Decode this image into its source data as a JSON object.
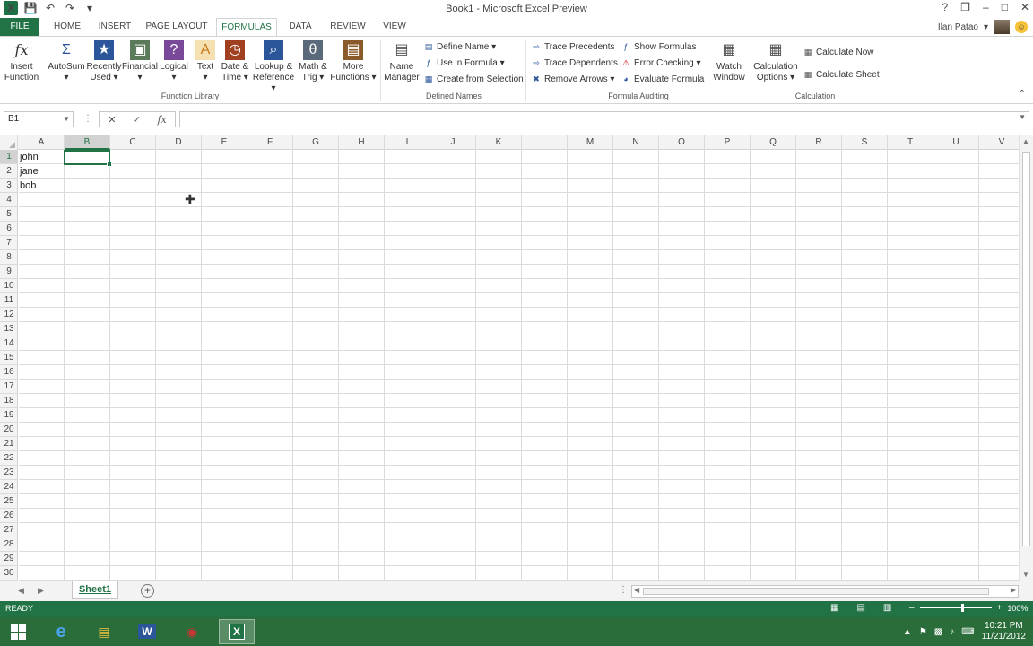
{
  "window": {
    "title": "Book1 - Microsoft Excel Preview",
    "app_icon_label": "X",
    "controls": [
      "?",
      "❒",
      "–",
      "□",
      "✕"
    ]
  },
  "user": {
    "name": "Ilan Patao"
  },
  "tabs": [
    {
      "label": "FILE"
    },
    {
      "label": "HOME"
    },
    {
      "label": "INSERT"
    },
    {
      "label": "PAGE LAYOUT"
    },
    {
      "label": "FORMULAS"
    },
    {
      "label": "DATA"
    },
    {
      "label": "REVIEW"
    },
    {
      "label": "VIEW"
    }
  ],
  "ribbon": {
    "function_library": {
      "label": "Function Library",
      "buttons": [
        {
          "line1": "Insert",
          "line2": "Function",
          "icon": "fx"
        },
        {
          "line1": "AutoSum",
          "line2": "▾",
          "icon": "Σ"
        },
        {
          "line1": "Recently",
          "line2": "Used ▾",
          "icon": "★"
        },
        {
          "line1": "Financial",
          "line2": "▾",
          "icon": "▣"
        },
        {
          "line1": "Logical",
          "line2": "▾",
          "icon": "?"
        },
        {
          "line1": "Text",
          "line2": "▾",
          "icon": "A"
        },
        {
          "line1": "Date &",
          "line2": "Time ▾",
          "icon": "◷"
        },
        {
          "line1": "Lookup &",
          "line2": "Reference ▾",
          "icon": "⌕"
        },
        {
          "line1": "Math &",
          "line2": "Trig ▾",
          "icon": "θ"
        },
        {
          "line1": "More",
          "line2": "Functions ▾",
          "icon": "▤"
        }
      ]
    },
    "defined_names": {
      "label": "Defined Names",
      "name_manager": {
        "line1": "Name",
        "line2": "Manager"
      },
      "items": [
        "Define Name ▾",
        "Use in Formula ▾",
        "Create from Selection"
      ]
    },
    "formula_auditing": {
      "label": "Formula Auditing",
      "items_left": [
        "Trace Precedents",
        "Trace Dependents",
        "Remove Arrows ▾"
      ],
      "items_right": [
        "Show Formulas",
        "Error Checking ▾",
        "Evaluate Formula"
      ],
      "watch_window": {
        "line1": "Watch",
        "line2": "Window"
      }
    },
    "calculation": {
      "label": "Calculation",
      "options": {
        "line1": "Calculation",
        "line2": "Options ▾"
      },
      "items": [
        "Calculate Now",
        "Calculate Sheet"
      ]
    }
  },
  "formula_bar": {
    "name_box": "B1",
    "formula": "",
    "buttons": [
      "✕",
      "✓",
      "fx"
    ]
  },
  "grid": {
    "columns": [
      "A",
      "B",
      "C",
      "D",
      "E",
      "F",
      "G",
      "H",
      "I",
      "J",
      "K",
      "L",
      "M",
      "N",
      "O",
      "P",
      "Q",
      "R",
      "S",
      "T",
      "U",
      "V"
    ],
    "rows": [
      "1",
      "2",
      "3",
      "4",
      "5",
      "6",
      "7",
      "8",
      "9",
      "10",
      "11",
      "12",
      "13",
      "14",
      "15",
      "16",
      "17",
      "18",
      "19",
      "20",
      "21",
      "22",
      "23",
      "24",
      "25",
      "26",
      "27",
      "28",
      "29",
      "30"
    ],
    "selected_column": "B",
    "selected_row": "1",
    "cells": [
      {
        "ref": "A1",
        "value": "john"
      },
      {
        "ref": "A2",
        "value": "jane"
      },
      {
        "ref": "A3",
        "value": "bob"
      }
    ]
  },
  "sheets": [
    {
      "name": "Sheet1",
      "active": true
    }
  ],
  "status": {
    "text": "READY",
    "zoom": "100%"
  },
  "taskbar": {
    "time": "10:21 PM",
    "date": "11/21/2012"
  },
  "colors": {
    "accent": "#217346",
    "taskbar": "#2b6d3a"
  }
}
